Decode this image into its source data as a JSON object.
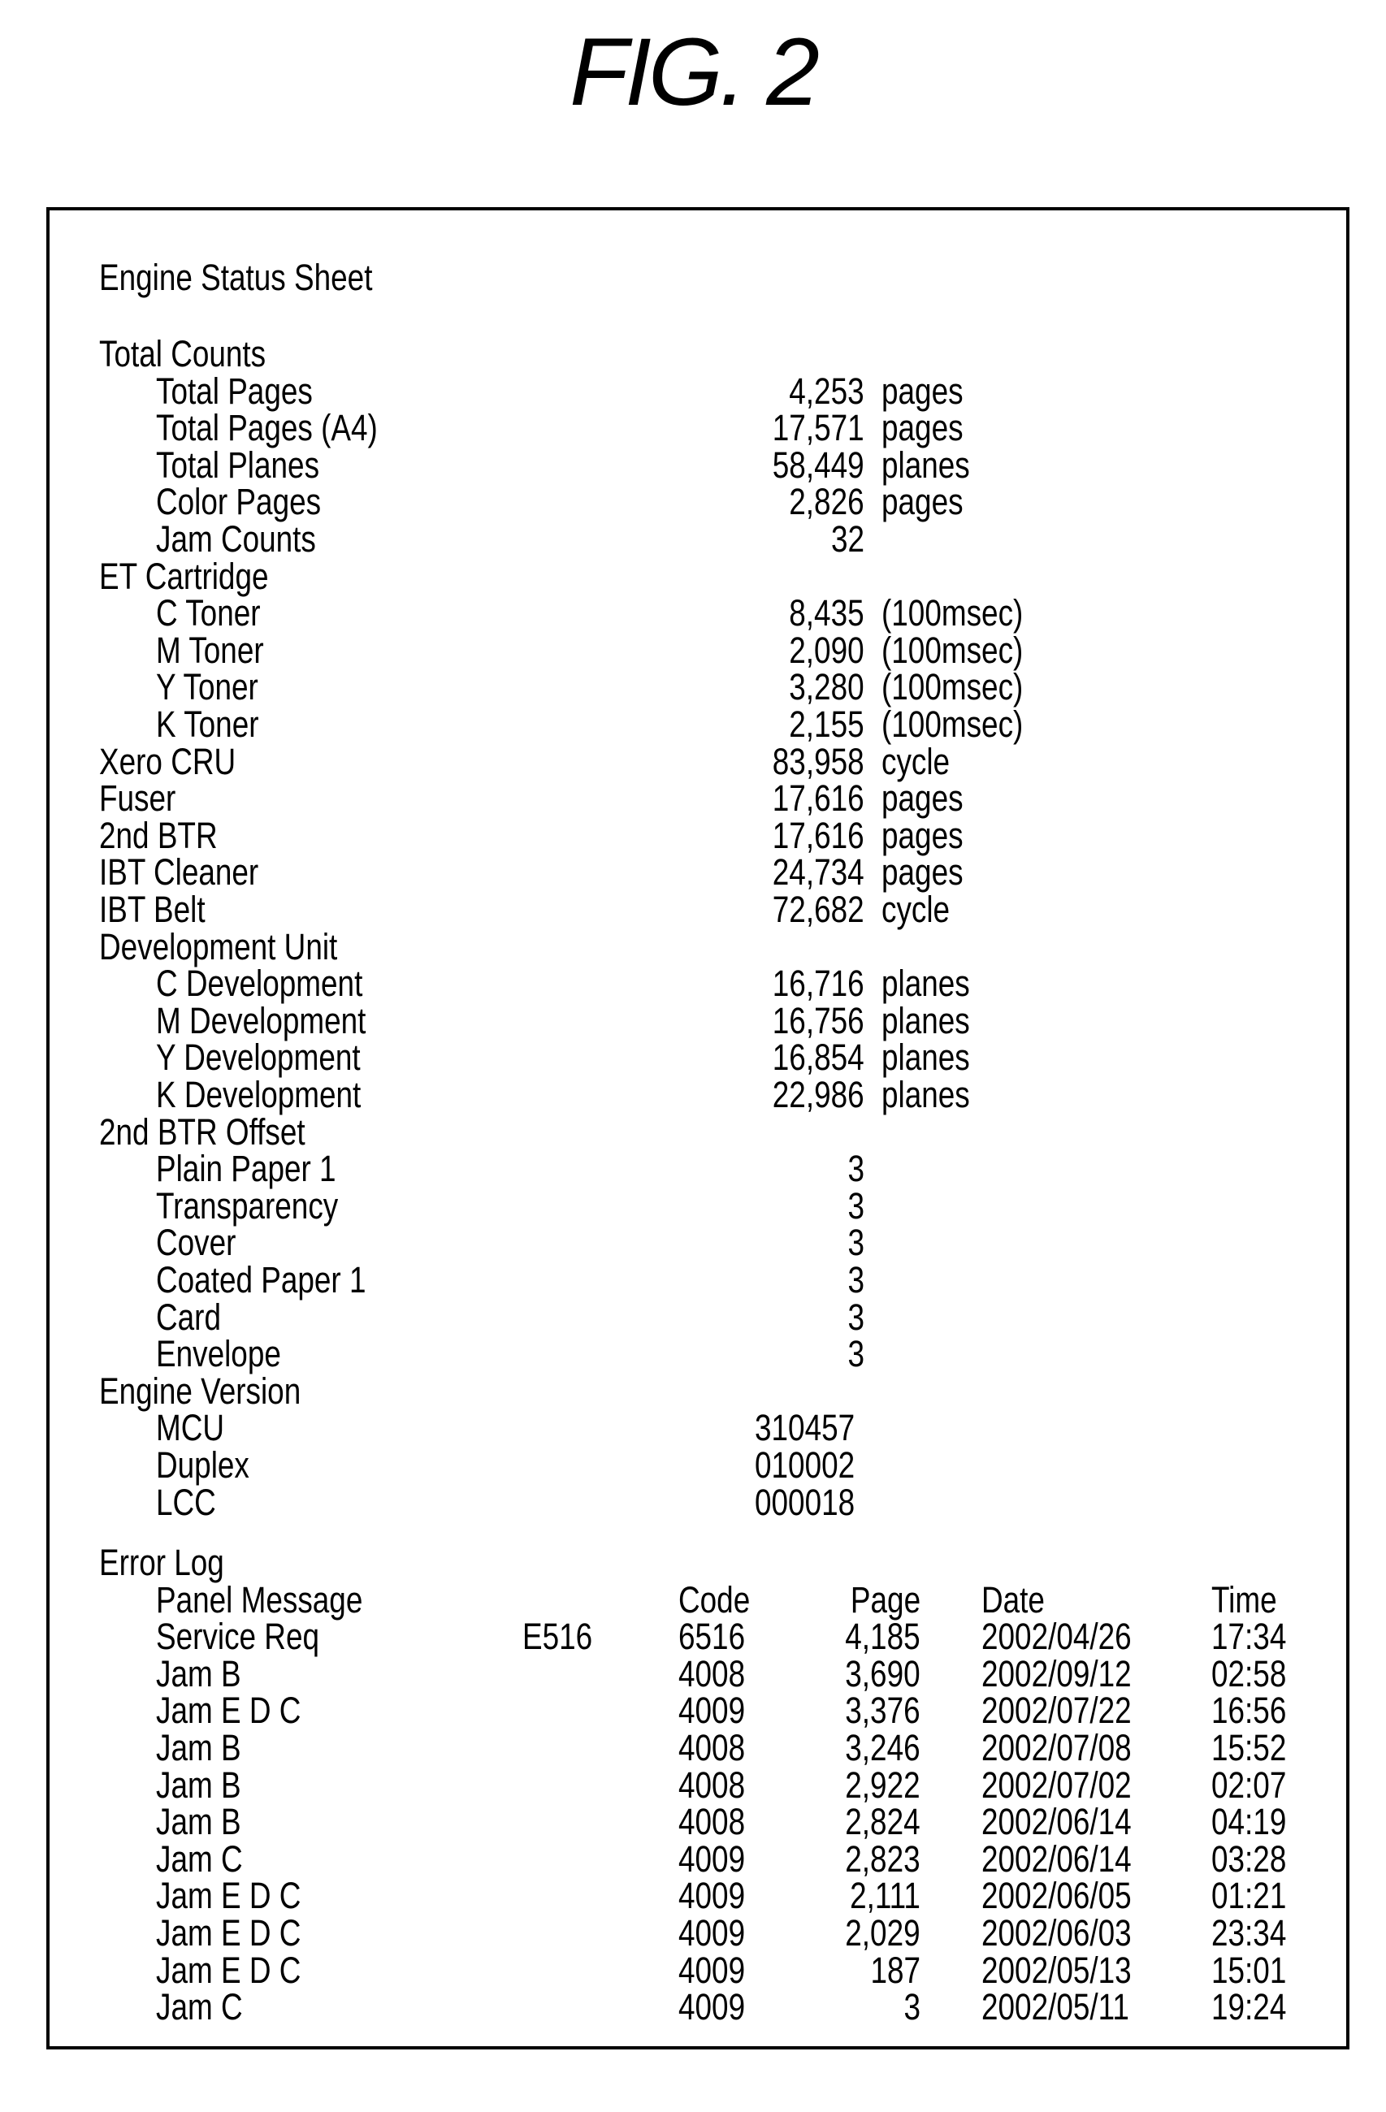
{
  "figure": {
    "title": "FIG. 2"
  },
  "sheet": {
    "title": "Engine Status Sheet",
    "sections": [
      {
        "label": "Total Counts",
        "items": [
          {
            "label": "Total Pages",
            "value": "4,253",
            "unit": "pages"
          },
          {
            "label": "Total Pages (A4)",
            "value": "17,571",
            "unit": "pages"
          },
          {
            "label": "Total Planes",
            "value": "58,449",
            "unit": "planes"
          },
          {
            "label": "Color Pages",
            "value": "2,826",
            "unit": "pages"
          },
          {
            "label": "Jam Counts",
            "value": "32",
            "unit": ""
          }
        ]
      },
      {
        "label": "ET Cartridge",
        "items": [
          {
            "label": "C Toner",
            "value": "8,435",
            "unit": "(100msec)"
          },
          {
            "label": "M Toner",
            "value": "2,090",
            "unit": "(100msec)"
          },
          {
            "label": "Y Toner",
            "value": "3,280",
            "unit": "(100msec)"
          },
          {
            "label": "K Toner",
            "value": "2,155",
            "unit": "(100msec)"
          }
        ]
      },
      {
        "label": "Xero CRU",
        "value": "83,958",
        "unit": "cycle",
        "items": []
      },
      {
        "label": "Fuser",
        "value": "17,616",
        "unit": "pages",
        "items": []
      },
      {
        "label": "2nd BTR",
        "value": "17,616",
        "unit": "pages",
        "items": []
      },
      {
        "label": "IBT Cleaner",
        "value": "24,734",
        "unit": "pages",
        "items": []
      },
      {
        "label": "IBT Belt",
        "value": "72,682",
        "unit": "cycle",
        "items": []
      },
      {
        "label": "Development Unit",
        "items": [
          {
            "label": "C Development",
            "value": "16,716",
            "unit": "planes"
          },
          {
            "label": "M Development",
            "value": "16,756",
            "unit": "planes"
          },
          {
            "label": "Y Development",
            "value": "16,854",
            "unit": "planes"
          },
          {
            "label": "K Development",
            "value": "22,986",
            "unit": "planes"
          }
        ]
      },
      {
        "label": "2nd BTR Offset",
        "items": [
          {
            "label": "Plain Paper 1",
            "value": "3",
            "unit": ""
          },
          {
            "label": "Transparency",
            "value": "3",
            "unit": ""
          },
          {
            "label": "Cover",
            "value": "3",
            "unit": ""
          },
          {
            "label": "Coated Paper 1",
            "value": "3",
            "unit": ""
          },
          {
            "label": "Card",
            "value": "3",
            "unit": ""
          },
          {
            "label": "Envelope",
            "value": "3",
            "unit": ""
          }
        ]
      },
      {
        "label": "Engine Version",
        "items": [
          {
            "label": "MCU",
            "version": "310457"
          },
          {
            "label": "Duplex",
            "version": "010002"
          },
          {
            "label": "LCC",
            "version": "000018"
          }
        ]
      }
    ],
    "error_log": {
      "label": "Error Log",
      "headers": {
        "message": "Panel Message",
        "code": "Code",
        "page": "Page",
        "date": "Date",
        "time": "Time"
      },
      "rows": [
        {
          "message": "Service Req",
          "panel_code": "E516",
          "code": "6516",
          "page": "4,185",
          "date": "2002/04/26",
          "time": "17:34"
        },
        {
          "message": "Jam B",
          "panel_code": "",
          "code": "4008",
          "page": "3,690",
          "date": "2002/09/12",
          "time": "02:58"
        },
        {
          "message": "Jam E D C",
          "panel_code": "",
          "code": "4009",
          "page": "3,376",
          "date": "2002/07/22",
          "time": "16:56"
        },
        {
          "message": "Jam B",
          "panel_code": "",
          "code": "4008",
          "page": "3,246",
          "date": "2002/07/08",
          "time": "15:52"
        },
        {
          "message": "Jam B",
          "panel_code": "",
          "code": "4008",
          "page": "2,922",
          "date": "2002/07/02",
          "time": "02:07"
        },
        {
          "message": "Jam B",
          "panel_code": "",
          "code": "4008",
          "page": "2,824",
          "date": "2002/06/14",
          "time": "04:19"
        },
        {
          "message": "Jam C",
          "panel_code": "",
          "code": "4009",
          "page": "2,823",
          "date": "2002/06/14",
          "time": "03:28"
        },
        {
          "message": "Jam E D C",
          "panel_code": "",
          "code": "4009",
          "page": "2,111",
          "date": "2002/06/05",
          "time": "01:21"
        },
        {
          "message": "Jam E D C",
          "panel_code": "",
          "code": "4009",
          "page": "2,029",
          "date": "2002/06/03",
          "time": "23:34"
        },
        {
          "message": "Jam E D C",
          "panel_code": "",
          "code": "4009",
          "page": "187",
          "date": "2002/05/13",
          "time": "15:01"
        },
        {
          "message": "Jam C",
          "panel_code": "",
          "code": "4009",
          "page": "3",
          "date": "2002/05/11",
          "time": "19:24"
        }
      ]
    }
  }
}
